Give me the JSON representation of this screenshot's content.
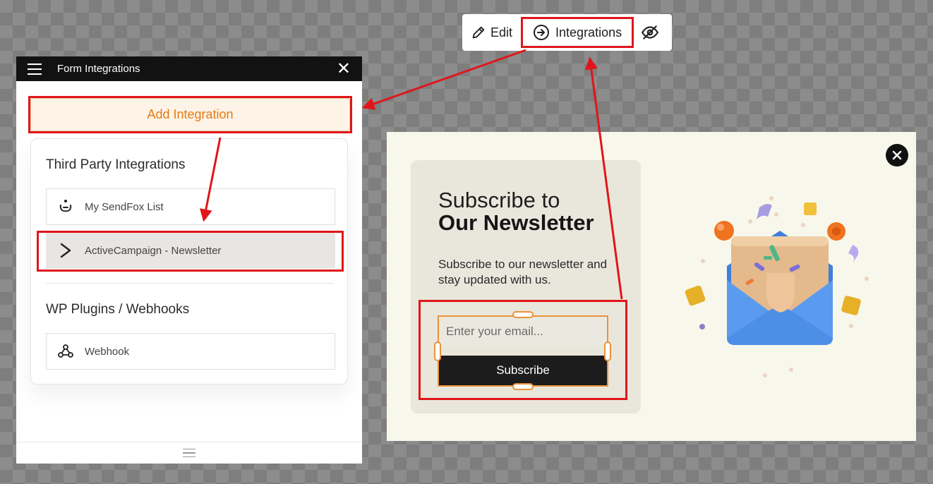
{
  "toolbar": {
    "edit_label": "Edit",
    "integrations_label": "Integrations",
    "icons": [
      "pencil-icon",
      "arrow-login-icon",
      "eye-off-icon"
    ]
  },
  "panel": {
    "title": "Form Integrations",
    "add_button": "Add Integration",
    "sections": [
      {
        "title": "Third Party Integrations",
        "items": [
          {
            "label": "My SendFox List",
            "icon": "sendfox-icon"
          },
          {
            "label": "ActiveCampaign - Newsletter",
            "icon": "activecampaign-icon",
            "selected": true
          }
        ]
      },
      {
        "title": "WP Plugins / Webhooks",
        "items": [
          {
            "label": "Webhook",
            "icon": "webhook-icon"
          }
        ]
      }
    ]
  },
  "popup": {
    "heading_line1": "Subscribe to",
    "heading_line2": "Our Newsletter",
    "description": "Subscribe to our newsletter and stay updated with us.",
    "email_placeholder": "Enter your email...",
    "button_label": "Subscribe"
  },
  "colors": {
    "highlight": "#e0161b",
    "accent_orange": "#e47a15",
    "popup_bg": "#f8f7ec",
    "card_bg": "#e9e7dc"
  }
}
